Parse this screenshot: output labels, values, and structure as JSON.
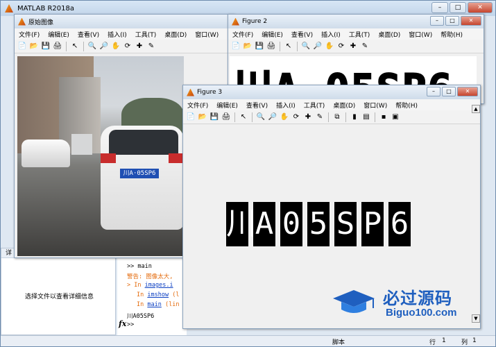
{
  "app": {
    "title": "MATLAB R2018a"
  },
  "figures": {
    "fig1": {
      "title": "原始图像",
      "plate_text": "川A·05SP6"
    },
    "fig2": {
      "title": "Figure 2",
      "plate_text": "川A 05SP6"
    },
    "fig3": {
      "title": "Figure 3",
      "chars": [
        "川",
        "A",
        "0",
        "5",
        "S",
        "P",
        "6"
      ]
    }
  },
  "menus": {
    "fig1": [
      "文件(F)",
      "编辑(E)",
      "查看(V)",
      "插入(I)",
      "工具(T)",
      "桌面(D)",
      "窗口(W)"
    ],
    "fig2": [
      "文件(F)",
      "编辑(E)",
      "查看(V)",
      "插入(I)",
      "工具(T)",
      "桌面(D)",
      "窗口(W)",
      "帮助(H)"
    ],
    "fig3": [
      "文件(F)",
      "编辑(E)",
      "查看(V)",
      "插入(I)",
      "工具(T)",
      "桌面(D)",
      "窗口(W)",
      "帮助(H)"
    ]
  },
  "details": {
    "header": "详",
    "message": "选择文件以查看详细信息"
  },
  "command_window": {
    "prompt": ">>",
    "cmd1": "main",
    "warn": "警告: 图像太大,",
    "in1": "In",
    "link1": "images.i",
    "link2": "imshow",
    "link2_tail": "(l",
    "link3": "main",
    "link3_tail": "(lin",
    "result": "川A05SP6",
    "fx": "fx"
  },
  "status": {
    "script": "脚本",
    "row_label": "行",
    "row_value": "1",
    "col_label": "列",
    "col_value": "1"
  },
  "watermark": {
    "cn": "必过源码",
    "en": "Biguo100.com"
  },
  "colors": {
    "accent": "#1f5fbf",
    "warning": "#e46b0d",
    "link": "#0a3ec2"
  }
}
